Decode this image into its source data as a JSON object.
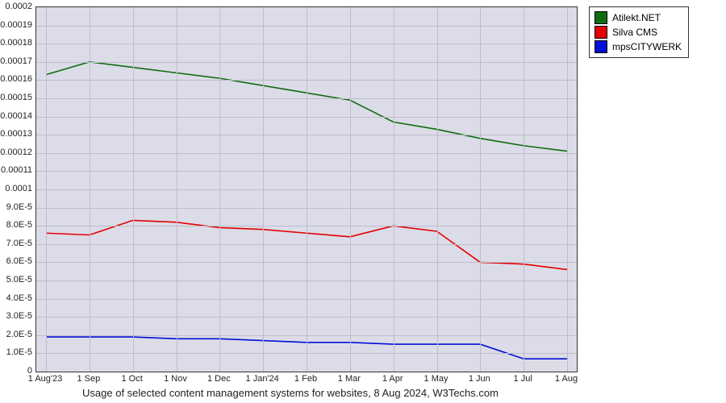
{
  "chart_data": {
    "type": "line",
    "caption": "Usage of selected content management systems for websites, 8 Aug 2024, W3Techs.com",
    "xlabel": "",
    "ylabel": "",
    "ylim": [
      0,
      0.0002
    ],
    "yticks": [
      0,
      1e-05,
      2e-05,
      3e-05,
      4e-05,
      5e-05,
      6e-05,
      7e-05,
      8e-05,
      9e-05,
      0.0001,
      0.00011,
      0.00012,
      0.00013,
      0.00014,
      0.00015,
      0.00016,
      0.00017,
      0.00018,
      0.00019,
      0.0002
    ],
    "ytick_labels": [
      "0",
      "1.0E-5",
      "2.0E-5",
      "3.0E-5",
      "4.0E-5",
      "5.0E-5",
      "6.0E-5",
      "7.0E-5",
      "8.0E-5",
      "9.0E-5",
      "0.0001",
      "0.00011",
      "0.00012",
      "0.00013",
      "0.00014",
      "0.00015",
      "0.00016",
      "0.00017",
      "0.00018",
      "0.00019",
      "0.0002"
    ],
    "categories": [
      "1 Aug'23",
      "1 Sep",
      "1 Oct",
      "1 Nov",
      "1 Dec",
      "1 Jan'24",
      "1 Feb",
      "1 Mar",
      "1 Apr",
      "1 May",
      "1 Jun",
      "1 Jul",
      "1 Aug"
    ],
    "series": [
      {
        "name": "Atilekt.NET",
        "color": "#0e6d0e",
        "values": [
          0.000163,
          0.00017,
          0.000167,
          0.000164,
          0.000161,
          0.000157,
          0.000153,
          0.000149,
          0.000137,
          0.000133,
          0.000128,
          0.000124,
          0.000121
        ]
      },
      {
        "name": "Silva CMS",
        "color": "#e30000",
        "values": [
          7.6e-05,
          7.5e-05,
          8.3e-05,
          8.2e-05,
          7.9e-05,
          7.8e-05,
          7.6e-05,
          7.4e-05,
          8e-05,
          7.7e-05,
          6e-05,
          5.9e-05,
          5.6e-05
        ]
      },
      {
        "name": "mpsCITYWERK",
        "color": "#0010d8",
        "values": [
          1.9e-05,
          1.9e-05,
          1.9e-05,
          1.8e-05,
          1.8e-05,
          1.7e-05,
          1.6e-05,
          1.6e-05,
          1.5e-05,
          1.5e-05,
          1.5e-05,
          7e-06,
          7e-06
        ]
      }
    ]
  }
}
